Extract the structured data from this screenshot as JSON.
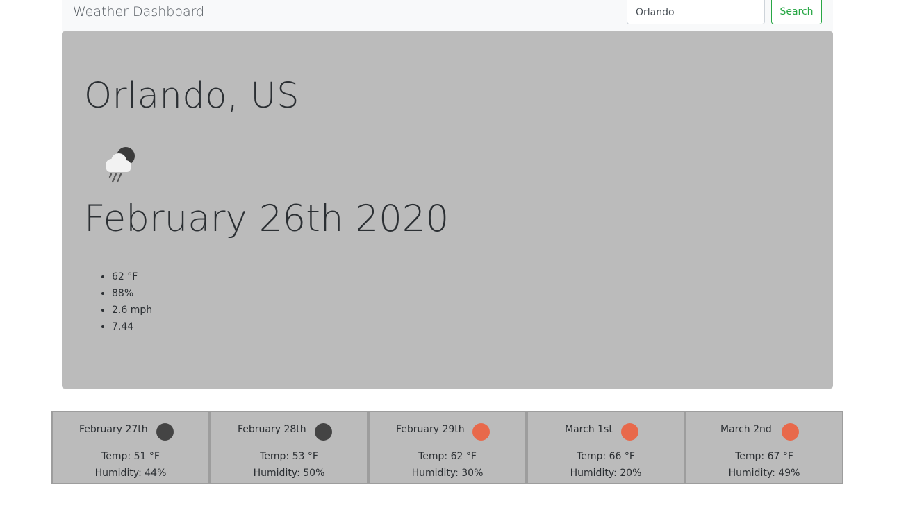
{
  "navbar": {
    "brand": "Weather Dashboard",
    "search_value": "Orlando",
    "search_button": "Search"
  },
  "current": {
    "city": "Orlando, US",
    "icon": "cloud-rain-night-icon",
    "date": "February 26th 2020",
    "stats": [
      "62 °F",
      "88%",
      "2.6 mph",
      "7.44"
    ]
  },
  "forecast": [
    {
      "date": "February 27th",
      "icon": "dark-circle-icon",
      "icon_color": "#444444",
      "temp": "Temp: 51 °F",
      "humidity": "Humidity: 44%"
    },
    {
      "date": "February 28th",
      "icon": "dark-circle-icon",
      "icon_color": "#444444",
      "temp": "Temp: 53 °F",
      "humidity": "Humidity: 50%"
    },
    {
      "date": "February 29th",
      "icon": "sun-circle-icon",
      "icon_color": "#e8694b",
      "temp": "Temp: 62 °F",
      "humidity": "Humidity: 30%"
    },
    {
      "date": "March 1st",
      "icon": "sun-circle-icon",
      "icon_color": "#e8694b",
      "temp": "Temp: 66 °F",
      "humidity": "Humidity: 20%"
    },
    {
      "date": "March 2nd",
      "icon": "sun-circle-icon",
      "icon_color": "#e8694b",
      "temp": "Temp: 67 °F",
      "humidity": "Humidity: 49%"
    }
  ],
  "colors": {
    "accent": "#28a745",
    "panel": "#bbbbbb",
    "navbar": "#f8f9fa"
  }
}
